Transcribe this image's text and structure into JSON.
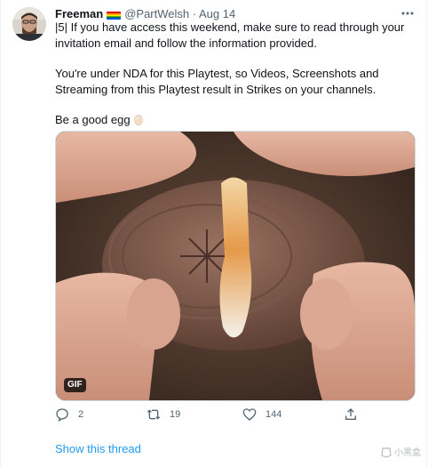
{
  "tweet": {
    "author_name": "Freeman",
    "handle": "@PartWelsh",
    "separator": "·",
    "date": "Aug 14",
    "paragraphs": [
      "|5| If you have access this weekend, make sure to read through your invitation email and follow the information provided.",
      "You're under NDA for this Playtest, so Videos, Screenshots and Streaming from this Playtest result in Strikes on your channels."
    ],
    "sign_off": "Be a good egg",
    "media_badge": "GIF",
    "reply_count": "2",
    "retweet_count": "19",
    "like_count": "144",
    "show_thread_label": "Show this thread"
  },
  "icons": {
    "more": "more-horizontal-icon",
    "reply": "reply-icon",
    "retweet": "retweet-icon",
    "like": "heart-icon",
    "share": "share-icon",
    "flag": "rainbow-flag-icon",
    "egg": "egg-icon"
  },
  "colors": {
    "link": "#1d9bf0",
    "secondary_text": "#536471",
    "primary_text": "#0f1419"
  },
  "watermark": {
    "text": "小黑盒"
  }
}
